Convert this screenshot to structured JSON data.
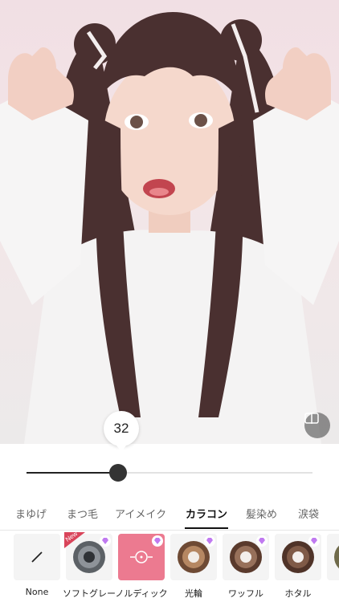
{
  "slider": {
    "value": 32,
    "value_text": "32",
    "min": 0,
    "max": 100
  },
  "tabs": [
    {
      "label": "まゆげ",
      "active": false
    },
    {
      "label": "まつ毛",
      "active": false
    },
    {
      "label": "アイメイク",
      "active": false
    },
    {
      "label": "カラコン",
      "active": true
    },
    {
      "label": "髪染め",
      "active": false
    },
    {
      "label": "涙袋",
      "active": false
    }
  ],
  "items": [
    {
      "label": "None",
      "icon": "none-slash-icon"
    },
    {
      "label": "ソフトグレー",
      "icon": "lens-gray-icon",
      "badge": "New",
      "premium": true
    },
    {
      "label": "ノルディック",
      "icon": "lens-selected-icon",
      "selected": true,
      "premium": true
    },
    {
      "label": "光輪",
      "icon": "lens-brown-icon",
      "premium": true
    },
    {
      "label": "ワッフル",
      "icon": "lens-brown-icon",
      "premium": true
    },
    {
      "label": "ホタル",
      "icon": "lens-brown-icon",
      "premium": true
    },
    {
      "label": "オ",
      "icon": "lens-olive-icon",
      "premium": true
    }
  ],
  "colors": {
    "accent": "#ec7a90",
    "active_text": "#111111",
    "track": "#e2e2e2",
    "thumb": "#333333"
  }
}
